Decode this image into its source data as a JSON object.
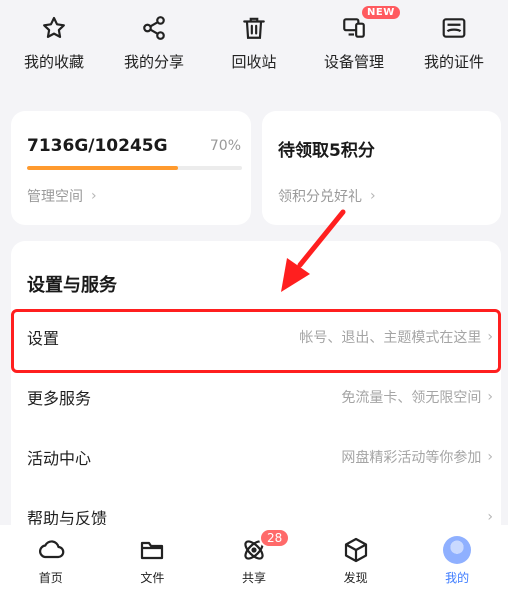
{
  "quick_actions": [
    {
      "label": "我的收藏",
      "icon": "star-icon"
    },
    {
      "label": "我的分享",
      "icon": "share-icon"
    },
    {
      "label": "回收站",
      "icon": "trash-icon"
    },
    {
      "label": "设备管理",
      "icon": "device-icon",
      "badge": "NEW"
    },
    {
      "label": "我的证件",
      "icon": "id-card-icon"
    }
  ],
  "storage": {
    "usage_text": "7136G/10245G",
    "percent_text": "70%",
    "percent": 0.7,
    "manage_label": "管理空间"
  },
  "points": {
    "title": "待领取5积分",
    "link_label": "领积分兑好礼"
  },
  "services": {
    "title": "设置与服务",
    "rows": [
      {
        "label": "设置",
        "hint": "帐号、退出、主题模式在这里"
      },
      {
        "label": "更多服务",
        "hint": "免流量卡、领无限空间"
      },
      {
        "label": "活动中心",
        "hint": "网盘精彩活动等你参加"
      },
      {
        "label": "帮助与反馈",
        "hint": ""
      }
    ]
  },
  "bottom_nav": [
    {
      "label": "首页",
      "icon": "home-cloud-icon"
    },
    {
      "label": "文件",
      "icon": "folder-icon"
    },
    {
      "label": "共享",
      "icon": "share-orbit-icon",
      "badge": "28"
    },
    {
      "label": "发现",
      "icon": "discover-box-icon"
    },
    {
      "label": "我的",
      "icon": "avatar",
      "active": true
    }
  ],
  "colors": {
    "progress": "#ff9a2e",
    "highlight": "#ff1f1f",
    "active_nav": "#3d7bff",
    "badge": "#ff5a5f"
  }
}
